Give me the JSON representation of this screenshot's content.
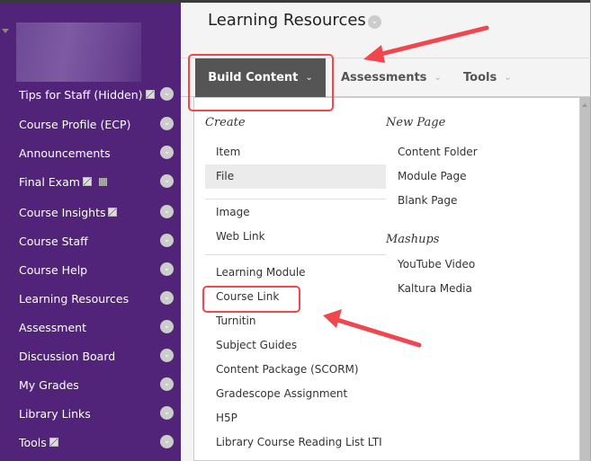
{
  "sidebar": {
    "items": [
      {
        "label": "Tips for Staff (Hidden)",
        "edit": true
      },
      {
        "label": "Course Profile (ECP)"
      },
      {
        "label": "Announcements"
      },
      {
        "label": "Final Exam",
        "edit": true,
        "grid": true
      },
      {
        "label": "Course Insights",
        "edit": true
      },
      {
        "label": "Course Staff"
      },
      {
        "label": "Course Help"
      },
      {
        "label": "Learning Resources"
      },
      {
        "label": "Assessment"
      },
      {
        "label": "Discussion Board"
      },
      {
        "label": "My Grades"
      },
      {
        "label": "Library Links"
      },
      {
        "label": "Tools",
        "edit": true
      }
    ]
  },
  "header": {
    "title": "Learning Resources"
  },
  "tabs": [
    {
      "label": "Build Content"
    },
    {
      "label": "Assessments"
    },
    {
      "label": "Tools"
    }
  ],
  "menu": {
    "create_label": "Create",
    "create": [
      "Item",
      "File",
      "Image",
      "Web Link",
      "Learning Module",
      "Course Link",
      "Turnitin",
      "Subject Guides",
      "Content Package (SCORM)",
      "Gradescope Assignment",
      "H5P",
      "Library Course Reading List LTI"
    ],
    "newpage_label": "New Page",
    "newpage": [
      "Content Folder",
      "Module Page",
      "Blank Page"
    ],
    "mashups_label": "Mashups",
    "mashups": [
      "YouTube Video",
      "Kaltura Media"
    ],
    "highlighted": "File"
  },
  "colors": {
    "sidebar": "#51247a",
    "annotation": "#f0474f",
    "active_tab": "#555555"
  }
}
